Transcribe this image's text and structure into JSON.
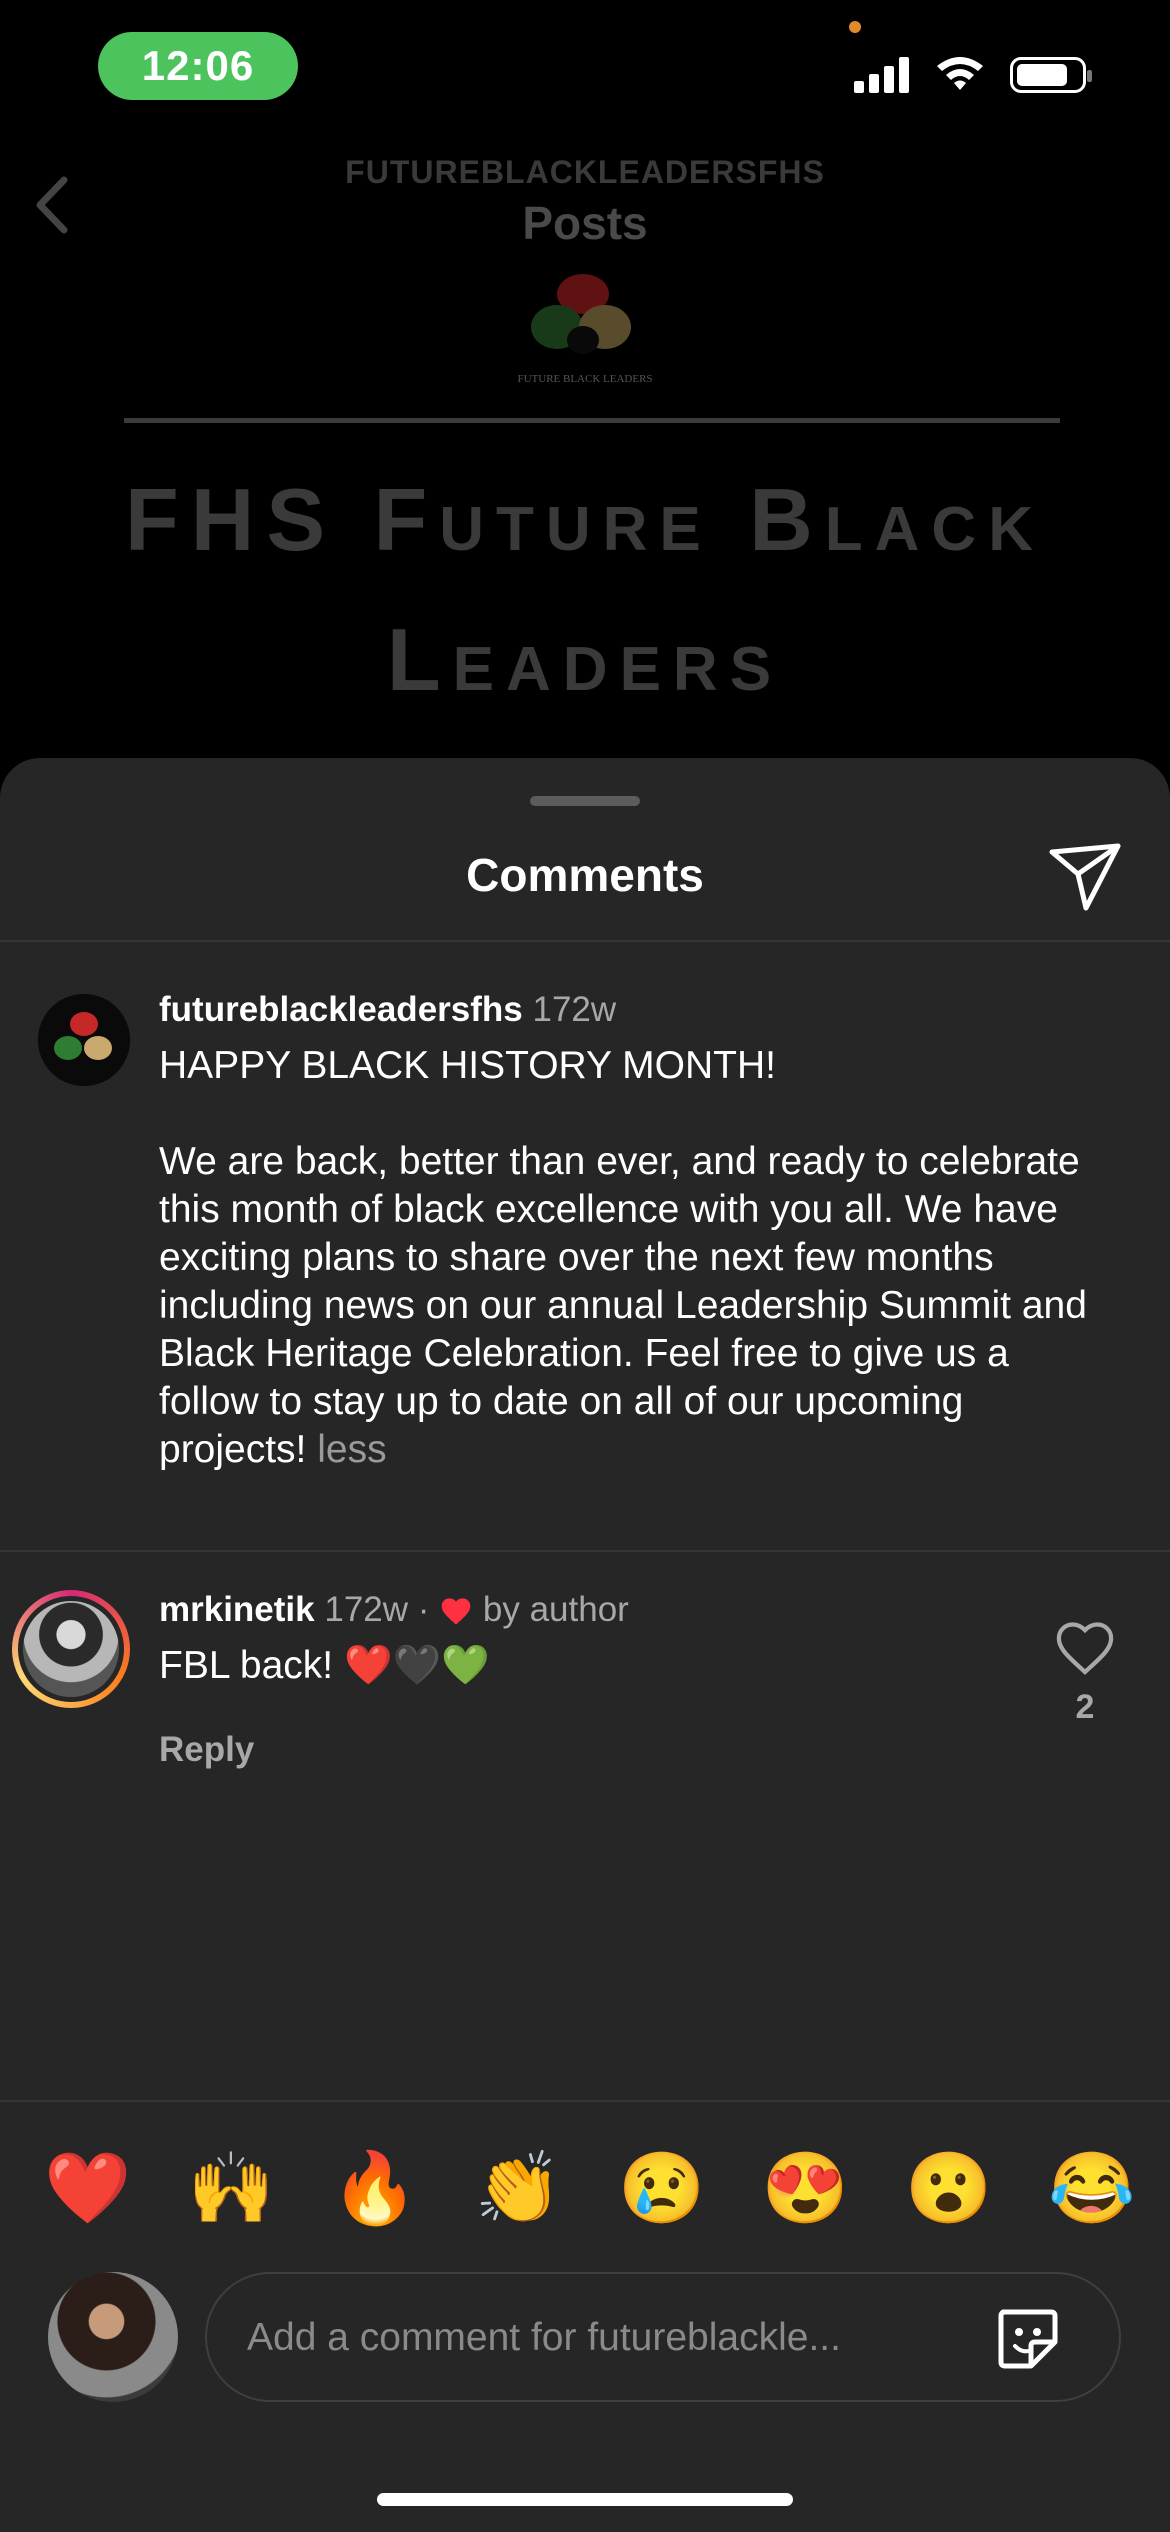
{
  "status_bar": {
    "time": "12:06"
  },
  "header": {
    "subtitle": "FUTUREBLACKLEADERSFHS",
    "title": "Posts"
  },
  "post": {
    "logo_caption": "FUTURE BLACK LEADERS",
    "title": "FHS Future Black Leaders"
  },
  "sheet": {
    "title": "Comments"
  },
  "comments": [
    {
      "username": "futureblackleadersfhs",
      "time": "172w",
      "line1": "HAPPY BLACK HISTORY MONTH!",
      "body": "We are back, better than ever, and ready to celebrate this month of black excellence with you all. We have exciting plans to share over the next few months including news on our annual Leadership Summit and Black Heritage Celebration. Feel free to give us a follow to stay up to date on all of our upcoming projects!",
      "toggle": "less"
    },
    {
      "username": "mrkinetik",
      "time": "172w",
      "separator": "·",
      "badge": "by author",
      "text": "FBL back! ❤️🖤💚",
      "reply_label": "Reply",
      "like_count": "2"
    }
  ],
  "reactions": [
    "❤️",
    "🙌",
    "🔥",
    "👏",
    "😢",
    "😍",
    "😮",
    "😂"
  ],
  "input": {
    "placeholder": "Add a comment for futureblackle..."
  },
  "colors": {
    "accent_green": "#4cc35c",
    "heart_red": "#ff3040",
    "sheet_bg": "#262626"
  }
}
